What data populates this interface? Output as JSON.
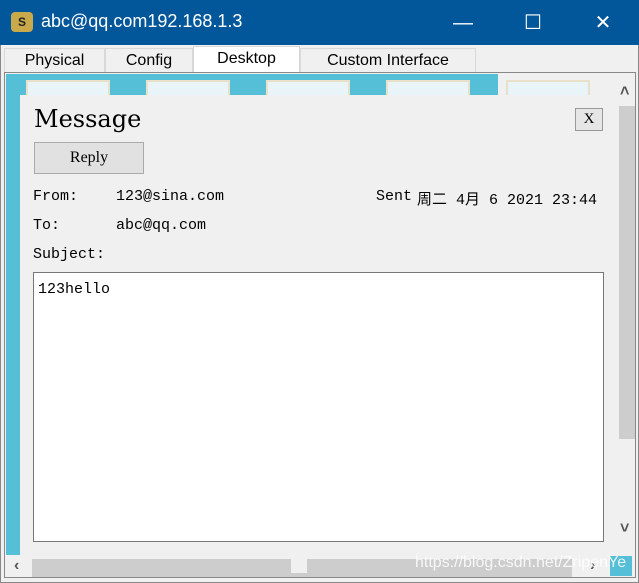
{
  "window": {
    "title": "abc@qq.com192.168.1.3",
    "icon": "email-app-icon"
  },
  "tabs": [
    {
      "label": "Physical"
    },
    {
      "label": "Config"
    },
    {
      "label": "Desktop",
      "active": true
    },
    {
      "label": "Custom Interface"
    }
  ],
  "message": {
    "title": "Message",
    "close_label": "X",
    "reply_label": "Reply",
    "from_label": "From:",
    "from_value": "123@sina.com",
    "sent_label": "Sent",
    "sent_value": "周二 4月 6 2021 23:44",
    "to_label": "To:",
    "to_value": "abc@qq.com",
    "subject_label": "Subject:",
    "subject_value": "",
    "body": "123hello"
  },
  "watermark": "https://blog.csdn.net/ZripenYe",
  "colors": {
    "titlebar": "#02579a",
    "desktop": "#54bfd6"
  }
}
